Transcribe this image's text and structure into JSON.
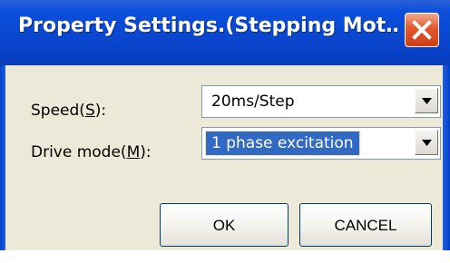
{
  "window": {
    "title": "Property Settings.(Stepping Mot…",
    "close_label": "Close"
  },
  "form": {
    "speed": {
      "label_prefix": "Speed(",
      "mnemonic": "S",
      "label_suffix": "):",
      "value": "20ms/Step"
    },
    "drive_mode": {
      "label_prefix": "Drive mode(",
      "mnemonic": "M",
      "label_suffix": "):",
      "value": "1 phase excitation"
    }
  },
  "buttons": {
    "ok": "OK",
    "cancel": "CANCEL"
  },
  "colors": {
    "titlebar": "#0a46cf",
    "dialog_bg": "#ece9d8",
    "selection": "#316ac5",
    "close_button": "#e2582d"
  },
  "icons": {
    "close": "close-icon",
    "dropdown": "chevron-down-icon"
  }
}
